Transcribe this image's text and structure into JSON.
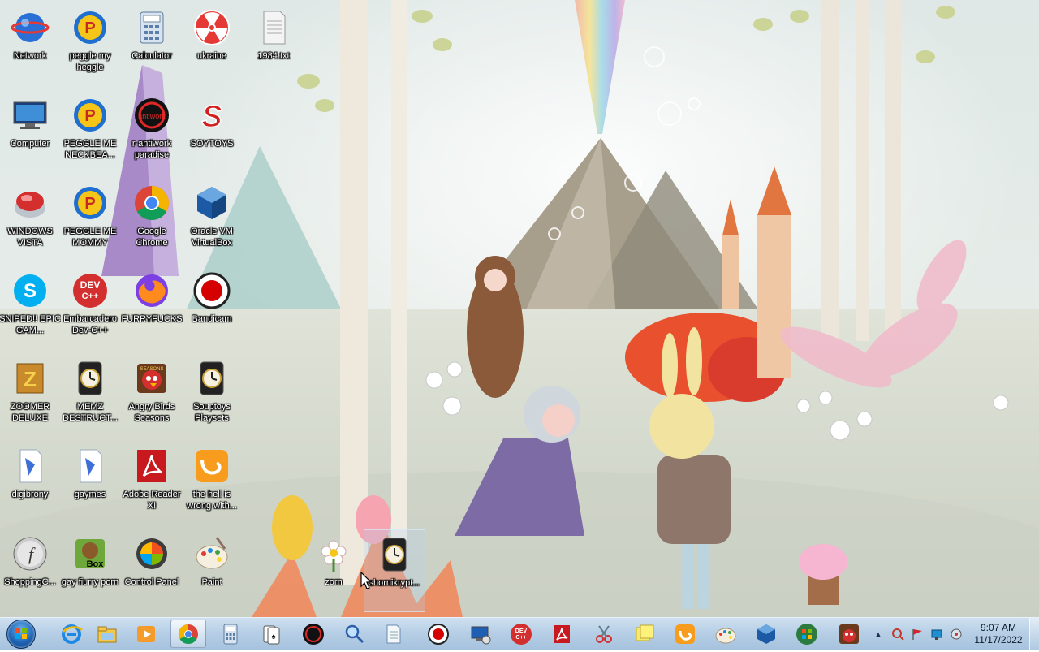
{
  "desktop": {
    "icons": [
      {
        "label": "Network",
        "icon": "network-globe-icon"
      },
      {
        "label": "peggle my heggle",
        "icon": "peggle-icon"
      },
      {
        "label": "Calculator",
        "icon": "calculator-icon"
      },
      {
        "label": "ukraine",
        "icon": "radiation-icon"
      },
      {
        "label": "1984.txt",
        "icon": "text-file-icon"
      },
      {
        "label": "Computer",
        "icon": "computer-icon"
      },
      {
        "label": "PEGGLE ME NECKBEA...",
        "icon": "peggle-icon"
      },
      {
        "label": "r-antiwork paradise",
        "icon": "antiwork-icon"
      },
      {
        "label": "SOYTOYS",
        "icon": "soytoys-icon"
      },
      {
        "label": "WINDOWS VISTA",
        "icon": "vista-icon"
      },
      {
        "label": "PEGGLE ME MOMMY",
        "icon": "peggle-icon"
      },
      {
        "label": "Google Chrome",
        "icon": "chrome-icon"
      },
      {
        "label": "Oracle VM VirtualBox",
        "icon": "virtualbox-icon"
      },
      {
        "label": "SNIPED!! EPIC GAM...",
        "icon": "skype-icon"
      },
      {
        "label": "Embarcadero Dev-C++",
        "icon": "devcpp-icon"
      },
      {
        "label": "FURRYFUCKS",
        "icon": "firefox-icon"
      },
      {
        "label": "Bandicam",
        "icon": "bandicam-icon"
      },
      {
        "label": "ZOOMER DELUXE",
        "icon": "zuma-icon"
      },
      {
        "label": "MEMZ DESTRUCT...",
        "icon": "clock-app-icon"
      },
      {
        "label": "Angry Birds Seasons",
        "icon": "angry-birds-icon"
      },
      {
        "label": "Souptoys Playsets",
        "icon": "clock-app-icon"
      },
      {
        "label": "digibrony",
        "icon": "shortcut-icon"
      },
      {
        "label": "gaymes",
        "icon": "shortcut-icon"
      },
      {
        "label": "Adobe Reader XI",
        "icon": "adobe-reader-icon"
      },
      {
        "label": "the hell is wrong with...",
        "icon": "uc-browser-icon"
      },
      {
        "label": "ShoppingC...",
        "icon": "flash-icon"
      },
      {
        "label": "gay fiurry porn",
        "icon": "box-icon"
      },
      {
        "label": "Control Panel",
        "icon": "control-panel-icon"
      },
      {
        "label": "Paint",
        "icon": "paint-icon"
      },
      {
        "label": "zorn",
        "icon": "flower-icon"
      },
      {
        "label": "shornikrypt...",
        "icon": "clock-app-icon"
      }
    ]
  },
  "taskbar": {
    "start_label": "Start",
    "pinned": [
      {
        "name": "internet-explorer"
      },
      {
        "name": "windows-explorer"
      },
      {
        "name": "media-player"
      },
      {
        "name": "google-chrome"
      },
      {
        "name": "calculator"
      },
      {
        "name": "solitaire"
      },
      {
        "name": "antiwork"
      },
      {
        "name": "search-magnifier"
      },
      {
        "name": "notepad-file"
      },
      {
        "name": "bandicam"
      },
      {
        "name": "remote-desktop"
      },
      {
        "name": "dev-cpp"
      },
      {
        "name": "adobe-reader"
      },
      {
        "name": "snipping-tool"
      },
      {
        "name": "sticky-notes"
      },
      {
        "name": "uc-browser"
      },
      {
        "name": "paint"
      },
      {
        "name": "virtualbox"
      },
      {
        "name": "windows-logo"
      },
      {
        "name": "angry-birds"
      }
    ],
    "clock": {
      "time": "9:07 AM",
      "date": "11/17/2022"
    }
  }
}
